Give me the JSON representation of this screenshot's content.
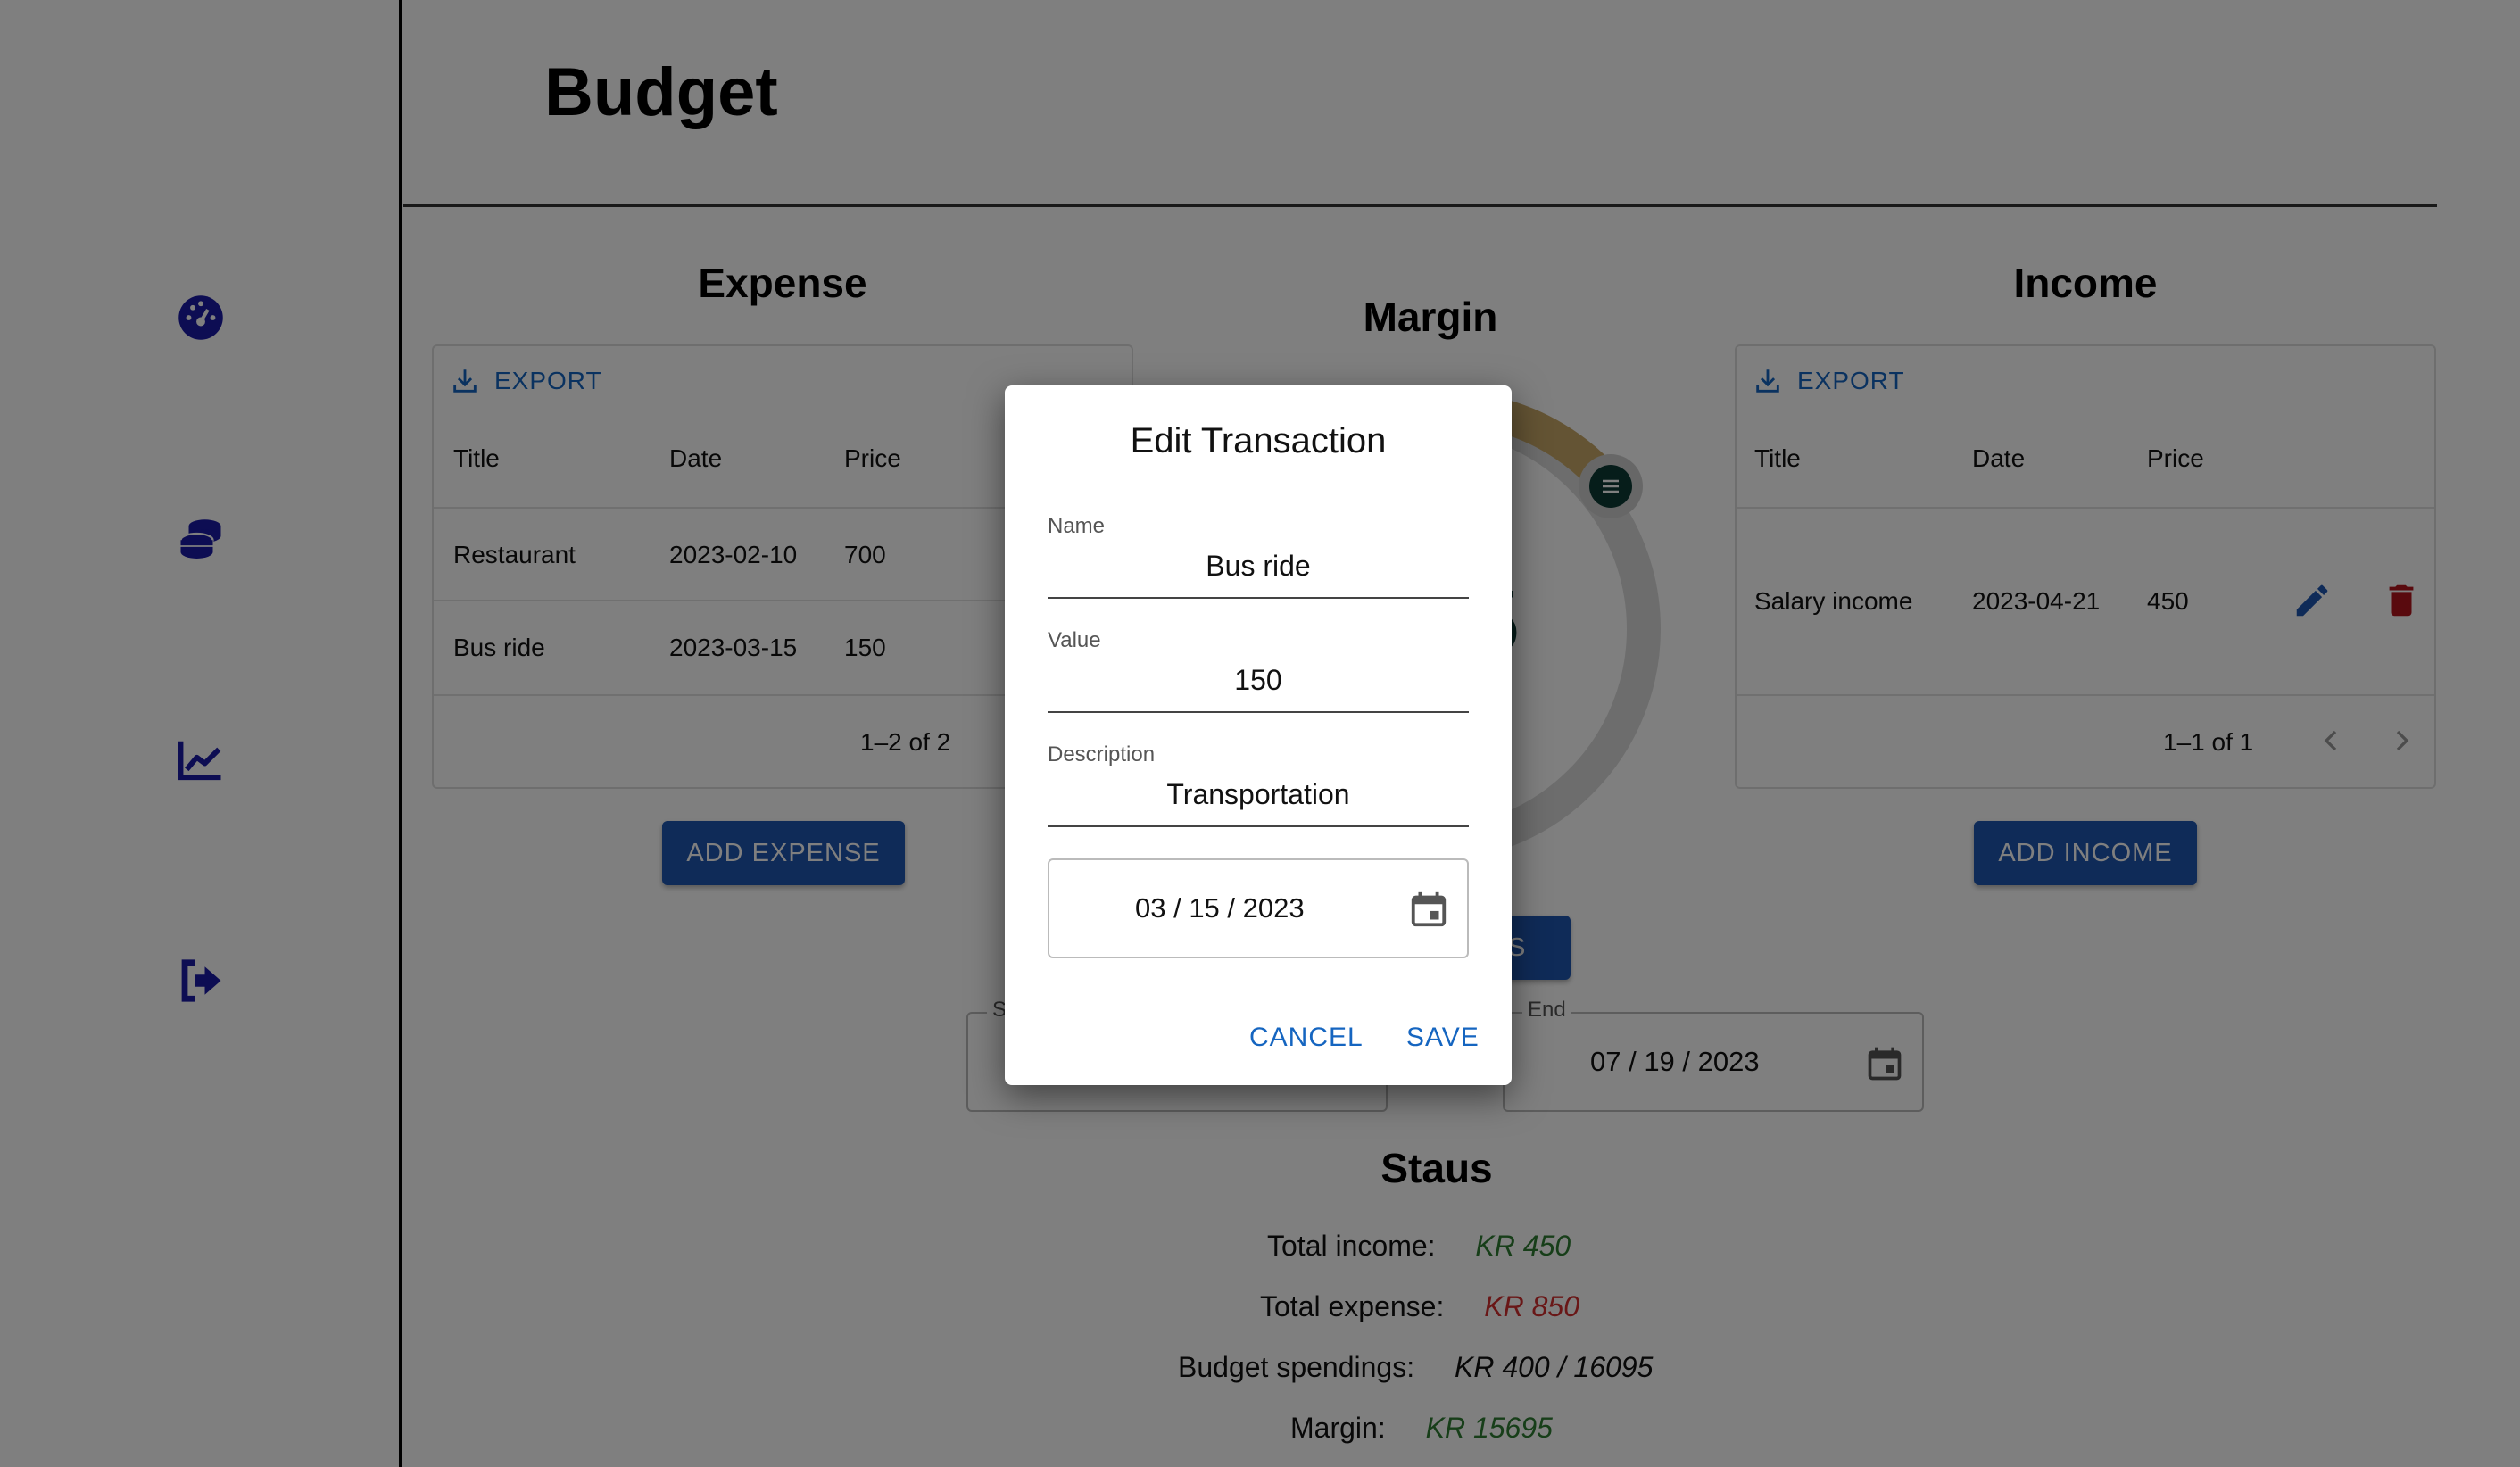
{
  "page": {
    "title": "Budget"
  },
  "sidebar": {
    "items": [
      {
        "icon": "dashboard-icon"
      },
      {
        "icon": "coins-icon"
      },
      {
        "icon": "chart-line-icon"
      },
      {
        "icon": "logout-icon"
      }
    ]
  },
  "expense": {
    "title": "Expense",
    "export_label": "EXPORT",
    "columns": [
      "Title",
      "Date",
      "Price"
    ],
    "rows": [
      {
        "title": "Restaurant",
        "date": "2023-02-10",
        "price": "700"
      },
      {
        "title": "Bus ride",
        "date": "2023-03-15",
        "price": "150"
      }
    ],
    "pagination": "1–2 of 2",
    "add_label": "ADD EXPENSE"
  },
  "income": {
    "title": "Income",
    "export_label": "EXPORT",
    "columns": [
      "Title",
      "Date",
      "Price"
    ],
    "rows": [
      {
        "title": "Salary income",
        "date": "2023-04-21",
        "price": "450"
      }
    ],
    "pagination": "1–1 of 1",
    "add_label": "ADD INCOME"
  },
  "margin": {
    "title": "Margin",
    "value_partial": "5",
    "button_partial": "ES"
  },
  "range": {
    "start_label_partial": "S",
    "end_label": "End",
    "end_value": "07 / 19 / 2023"
  },
  "status": {
    "title": "Staus",
    "lines": [
      {
        "label": "Total income:",
        "value": "KR 450"
      },
      {
        "label": "Total expense:",
        "value": "KR 850"
      },
      {
        "label": "Budget spendings:",
        "value": "KR 400 / 16095"
      },
      {
        "label": "Margin:",
        "value": "KR 15695"
      }
    ]
  },
  "dialog": {
    "title": "Edit Transaction",
    "name_label": "Name",
    "name_value": "Bus ride",
    "value_label": "Value",
    "value_value": "150",
    "description_label": "Description",
    "description_value": "Transportation",
    "date_value": "03 / 15 / 2023",
    "cancel_label": "CANCEL",
    "save_label": "SAVE"
  },
  "colors": {
    "primary": "#1e56b0",
    "link": "#1565c0",
    "income_green": "#2e7d32",
    "expense_red": "#d32f2f",
    "nav_icon": "#1a1aa6",
    "gauge_knob": "#0d3b35"
  }
}
